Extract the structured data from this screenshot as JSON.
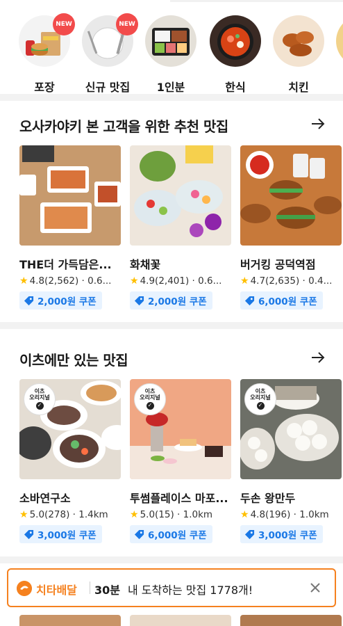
{
  "categories": [
    {
      "label": "포장",
      "badge": "NEW",
      "icon": "takeout-bag-icon"
    },
    {
      "label": "신규 맛집",
      "badge": "NEW",
      "icon": "utensils-icon"
    },
    {
      "label": "1인분",
      "badge": "",
      "icon": "lunchbox-icon"
    },
    {
      "label": "한식",
      "badge": "",
      "icon": "stew-icon"
    },
    {
      "label": "치킨",
      "badge": "",
      "icon": "chicken-icon"
    }
  ],
  "sections": [
    {
      "title": "오사카야키 본 고객을 위한 추천 맛집",
      "cards": [
        {
          "name": "THE더 가득담은...",
          "rating": "4.8",
          "reviews": "(2,562)",
          "distance": "0.6...",
          "coupon": "2,000원 쿠폰"
        },
        {
          "name": "화채꽃",
          "rating": "4.9",
          "reviews": "(2,401)",
          "distance": "0.6...",
          "coupon": "2,000원 쿠폰"
        },
        {
          "name": "버거킹 공덕역점",
          "rating": "4.7",
          "reviews": "(2,635)",
          "distance": "0.4...",
          "coupon": "6,000원 쿠폰"
        }
      ]
    },
    {
      "title": "이츠에만 있는 맛집",
      "badge_line1": "이츠",
      "badge_line2": "오리지널",
      "cards": [
        {
          "name": "소바연구소",
          "rating": "5.0",
          "reviews": "(278)",
          "distance": "1.4km",
          "coupon": "3,000원 쿠폰"
        },
        {
          "name": "투썸플레이스 마포...",
          "rating": "5.0",
          "reviews": "(15)",
          "distance": "1.0km",
          "coupon": "6,000원 쿠폰"
        },
        {
          "name": "두손 왕만두",
          "rating": "4.8",
          "reviews": "(196)",
          "distance": "1.0km",
          "coupon": "3,000원 쿠폰"
        }
      ]
    }
  ],
  "banner": {
    "brand": "치타배달",
    "time": "30분",
    "message": "내 도착하는 맛집  1778개!"
  },
  "colors": {
    "accent": "#f5811f",
    "coupon_text": "#1a78e6",
    "coupon_bg": "#e8f3ff",
    "new_badge": "#f24b4b",
    "star": "#ffbf00"
  }
}
